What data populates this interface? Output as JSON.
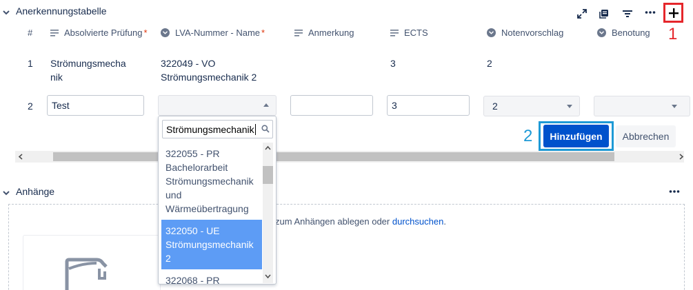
{
  "table_section": {
    "title": "Anerkennungstabelle",
    "columns": [
      {
        "label": "#"
      },
      {
        "label": "Absolvierte Prüfung",
        "required": "*"
      },
      {
        "label": "LVA-Nummer - Name",
        "required": "*"
      },
      {
        "label": "Anmerkung"
      },
      {
        "label": "ECTS"
      },
      {
        "label": "Notenvorschlag"
      },
      {
        "label": "Benotung"
      }
    ],
    "rows": [
      {
        "num": "1",
        "pruefung": "Strömungsmecha\nnik",
        "lva": "322049 - VO\nStrömungsmechanik 2",
        "anmerkung": "",
        "ects": "3",
        "notenvorschlag": "2",
        "benotung": ""
      }
    ],
    "edit_row": {
      "num": "2",
      "pruefung_value": "Test",
      "anmerkung_value": "",
      "ects_value": "3",
      "notenvorschlag_value": "2",
      "benotung_value": ""
    },
    "add_button": "Hinzufügen",
    "cancel_button": "Abbrechen"
  },
  "dropdown": {
    "search_value": "Strömungsmechanik",
    "options": [
      "322055 - PR\nBachelorarbeit\nStrömungsmechanik\nund\nWärmeübertragung",
      "322050 - UE\nStrömungsmechanik\n2",
      "322068 - PR"
    ],
    "selected_index": 1
  },
  "attachments_section": {
    "title": "Anhänge",
    "drop_text": "zum Anhängen ablegen oder",
    "browse_link": "durchsuchen",
    "period": "."
  },
  "callouts": {
    "one": "1",
    "two": "2"
  },
  "colors": {
    "accent": "#0052cc",
    "callout_red": "#e5262b",
    "callout_blue": "#1e9ad6",
    "selected_option": "#5d9cf5",
    "link": "#0052cc"
  }
}
